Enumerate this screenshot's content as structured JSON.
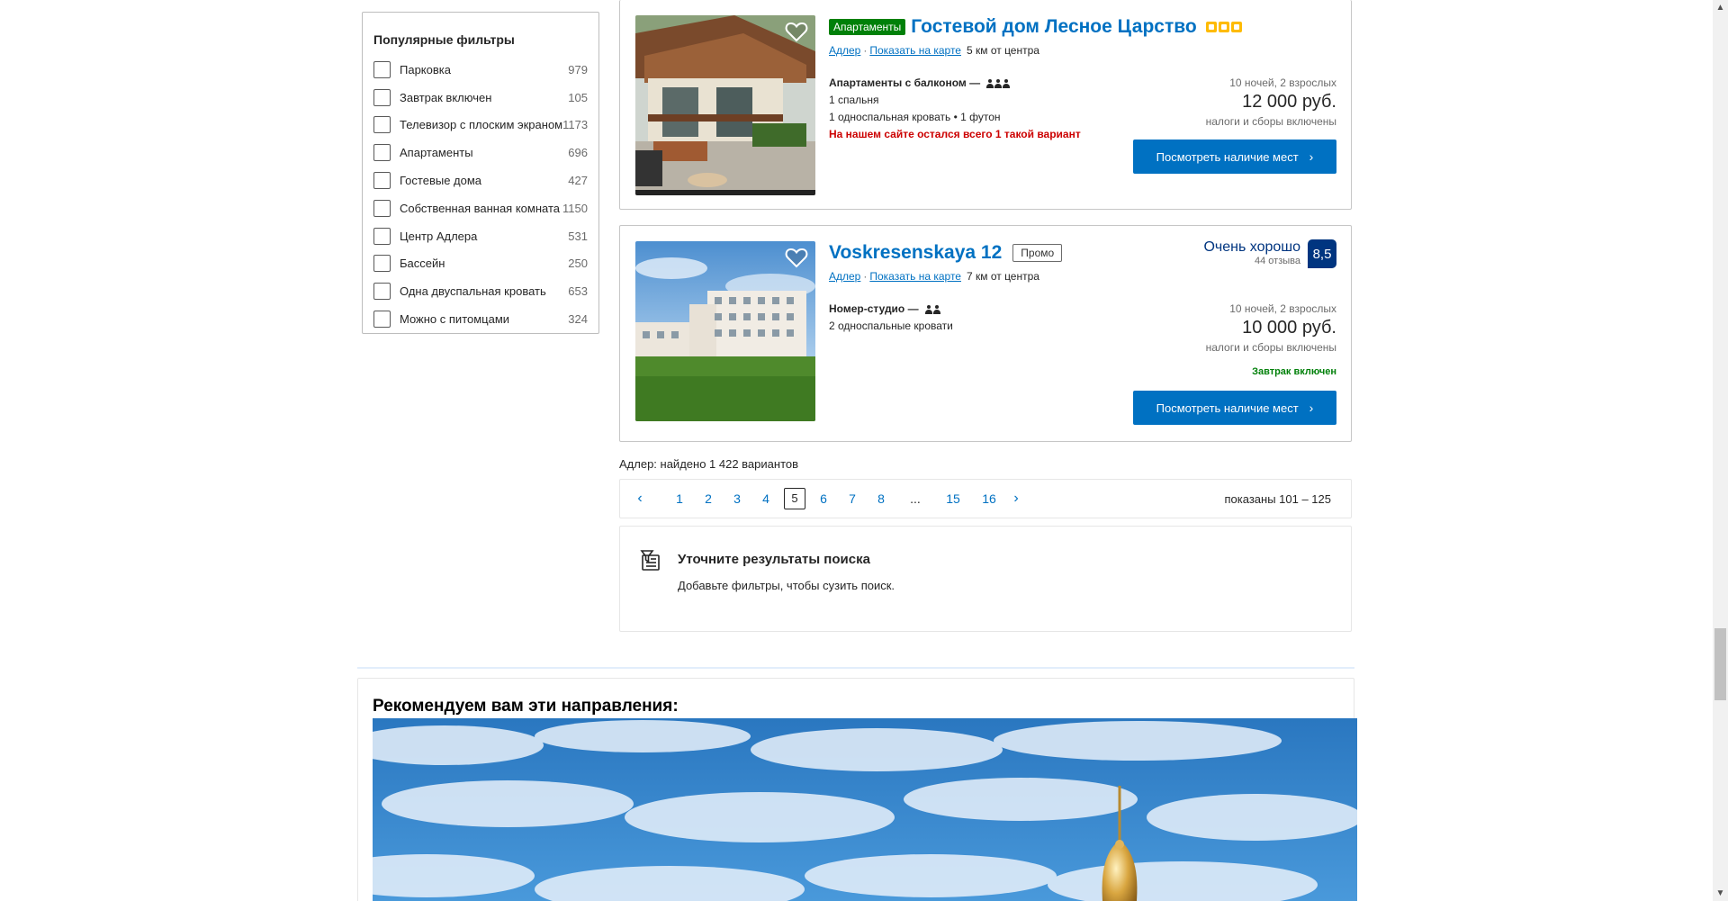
{
  "filters": {
    "title": "Популярные фильтры",
    "items": [
      {
        "label": "Парковка",
        "count": "979"
      },
      {
        "label": "Завтрак включен",
        "count": "105"
      },
      {
        "label": "Телевизор с плоским экраном",
        "count": "1173"
      },
      {
        "label": "Апартаменты",
        "count": "696"
      },
      {
        "label": "Гостевые дома",
        "count": "427"
      },
      {
        "label": "Собственная ванная комната",
        "count": "1150"
      },
      {
        "label": "Центр Адлера",
        "count": "531"
      },
      {
        "label": "Бассейн",
        "count": "250"
      },
      {
        "label": "Одна двуспальная кровать",
        "count": "653"
      },
      {
        "label": "Можно с питомцами",
        "count": "324"
      }
    ]
  },
  "properties": [
    {
      "type_badge": "Апартаменты",
      "title": "Гостевой дом Лесное Царство",
      "stars": 3,
      "district": "Адлер",
      "map_link": "Показать на карте",
      "distance": "5 км от центра",
      "unit_name": "Апартаменты с балконом",
      "unit_sep": "—",
      "occupancy": 3,
      "details": [
        "1 спальня",
        "1 односпальная кровать • 1 футон"
      ],
      "warning": "На нашем сайте остался всего 1 такой вариант",
      "stay": "10 ночей, 2 взрослых",
      "price": "12 000 руб.",
      "taxes": "налоги и сборы включены",
      "cta": "Посмотреть наличие мест"
    },
    {
      "title": "Voskresenskaya 12",
      "promo": "Промо",
      "district": "Адлер",
      "map_link": "Показать на карте",
      "distance": "7 км от центра",
      "score_word": "Очень хорошо",
      "reviews": "44 отзыва",
      "score": "8,5",
      "unit_name": "Номер-студио",
      "unit_sep": "—",
      "occupancy": 2,
      "details": [
        "2 односпальные кровати"
      ],
      "stay": "10 ночей, 2 взрослых",
      "price": "10 000 руб.",
      "taxes": "налоги и сборы включены",
      "breakfast": "Завтрак включен",
      "cta": "Посмотреть наличие мест"
    }
  ],
  "results": {
    "found": "Адлер: найдено 1 422 вариантов"
  },
  "pagination": {
    "pages": [
      "1",
      "2",
      "3",
      "4",
      "5",
      "6",
      "7",
      "8",
      "...",
      "15",
      "16"
    ],
    "current": "5",
    "shown": "показаны 101 – 125"
  },
  "refine": {
    "title": "Уточните результаты поиска",
    "subtitle": "Добавьте фильтры, чтобы сузить поиск."
  },
  "recommend": {
    "title": "Рекомендуем вам эти направления:"
  },
  "colors": {
    "brand_blue": "#0071c2",
    "dark_blue": "#003580",
    "green": "#008009",
    "star_yellow": "#febb02",
    "warning_red": "#cc0000"
  }
}
